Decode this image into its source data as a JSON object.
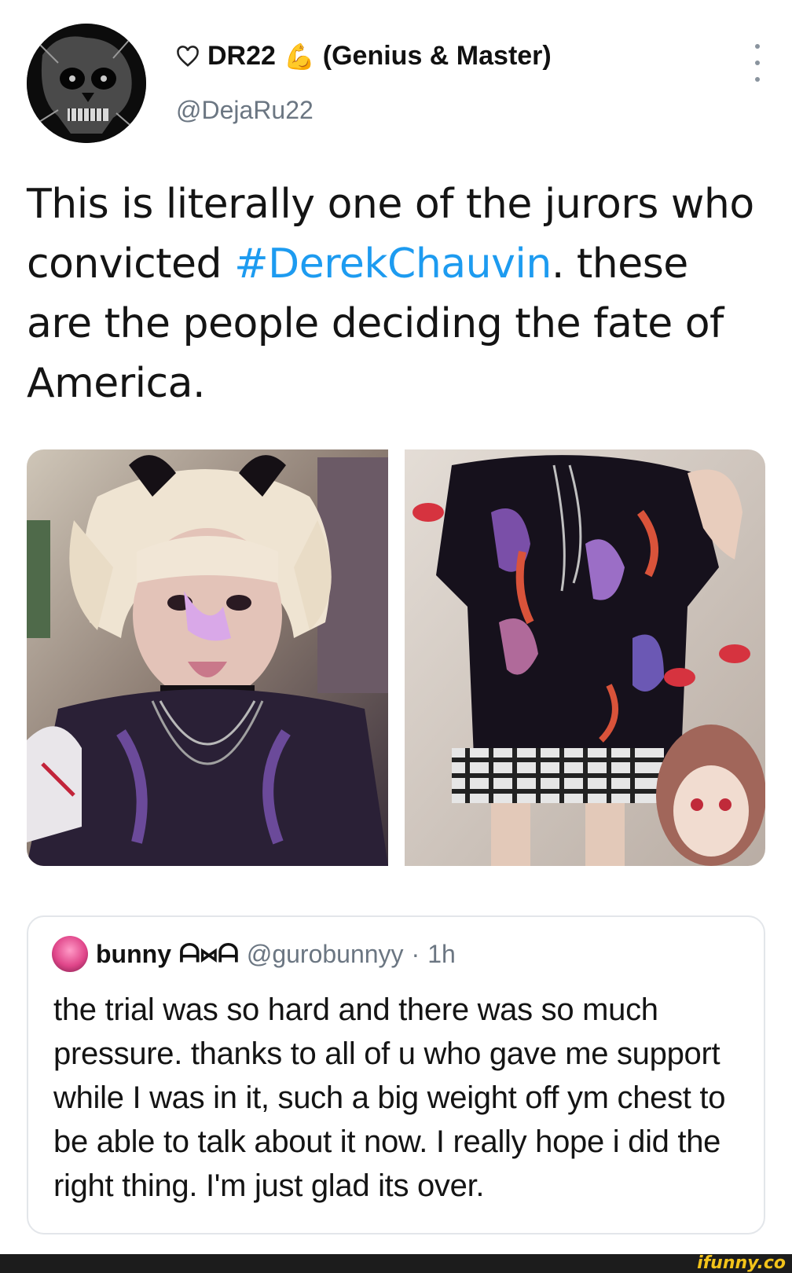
{
  "tweet": {
    "author_name": "DR22",
    "author_suffix": "(Genius & Master)",
    "handle": "@DejaRu22",
    "text_before": "This is literally one of the jurors who convicted ",
    "hashtag": "#DerekChauvin",
    "text_after": ". these are the people deciding the fate of America.",
    "icons": [
      "heart-icon",
      "flexed-biceps-icon",
      "more-vertical-icon"
    ]
  },
  "quote": {
    "name": "bunny",
    "emoticon": "ᗩ⋈ᗩ",
    "handle": "@gurobunnyy",
    "separator": "·",
    "time": "1h",
    "text": "the trial was so hard and there was so much pressure. thanks to all of u who gave me support while I was in it, such a big weight off ym chest to be able to talk about it now. I really hope i did the right thing. I'm just glad its over."
  },
  "watermark": "ifunny.co",
  "colors": {
    "hashtag": "#1d9bf0",
    "secondary_text": "#6b7682",
    "watermark": "#f2c31a"
  }
}
